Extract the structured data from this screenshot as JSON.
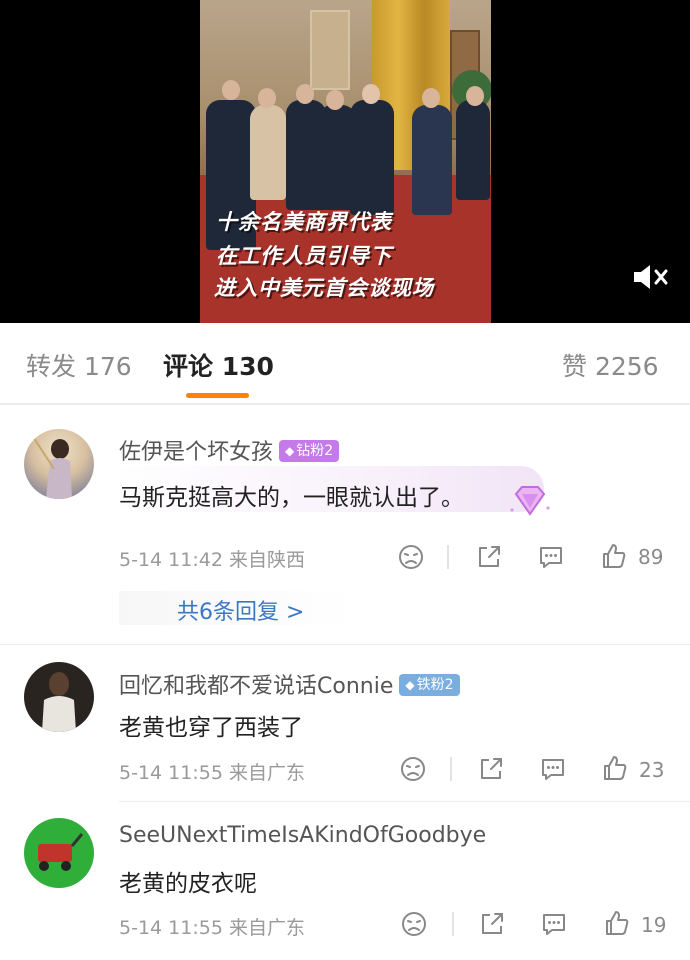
{
  "video": {
    "caption_lines": [
      "十余名美商界代表",
      "在工作人员引导下",
      "进入中美元首会谈现场"
    ],
    "mute_icon": "speaker-muted-icon"
  },
  "tabs": [
    {
      "label": "转发 176",
      "active": false
    },
    {
      "label": "评论 130",
      "active": true
    },
    {
      "label": "赞 2256",
      "active": false
    }
  ],
  "colors": {
    "accent": "#ff8200",
    "link": "#3b78c4",
    "diamond_badge": "#c47ae8",
    "iron_badge": "#7aaee0"
  },
  "comments": [
    {
      "username": "佐伊是个坏女孩",
      "badge": "钻粉2",
      "text": "马斯克挺高大的，一眼就认出了。",
      "meta": "5-14 11:42 来自陕西",
      "likes": "89",
      "replies": "共6条回复 >"
    },
    {
      "username": "回忆和我都不爱说话Connie",
      "badge": "铁粉2",
      "text": "老黄也穿了西装了",
      "meta": "5-14 11:55 来自广东",
      "likes": "23"
    },
    {
      "username": "SeeUNextTimeIsAKindOfGoodbye",
      "text": "老黄的皮衣呢",
      "meta": "5-14 11:55 来自广东",
      "likes": "19"
    }
  ]
}
